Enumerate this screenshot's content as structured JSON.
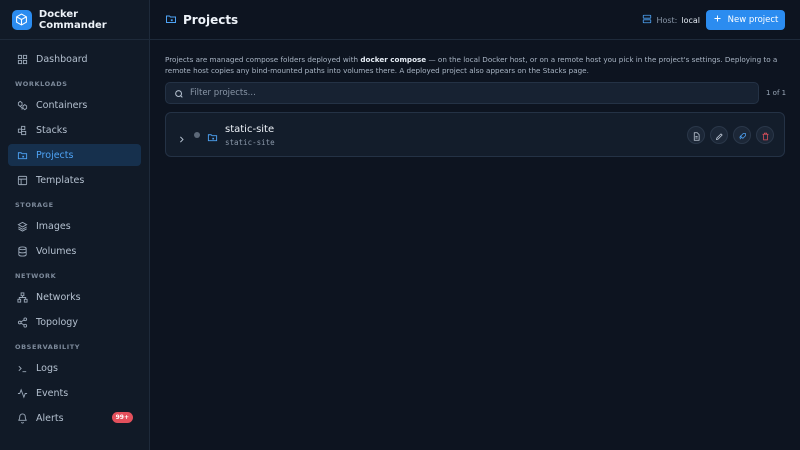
{
  "app": {
    "name": "Docker Commander"
  },
  "sidebar": {
    "dashboard": "Dashboard",
    "sections": {
      "workloads": "WORKLOADS",
      "storage": "STORAGE",
      "network": "NETWORK",
      "observability": "OBSERVABILITY"
    },
    "items": {
      "containers": "Containers",
      "stacks": "Stacks",
      "projects": "Projects",
      "templates": "Templates",
      "images": "Images",
      "volumes": "Volumes",
      "networks": "Networks",
      "topology": "Topology",
      "logs": "Logs",
      "events": "Events",
      "alerts": "Alerts"
    },
    "alerts_badge": "99+"
  },
  "header": {
    "title": "Projects",
    "host_label": "Host:",
    "host_value": "local",
    "new_button": "New project"
  },
  "main": {
    "description_pre": "Projects are managed compose folders deployed with ",
    "description_bold": "docker compose",
    "description_post": " — on the local Docker host, or on a remote host you pick in the project's settings. Deploying to a remote host copies any bind-mounted paths into volumes there. A deployed project also appears on the Stacks page.",
    "filter_placeholder": "Filter projects...",
    "pager": "1 of 1",
    "projects": [
      {
        "name": "static-site",
        "subtitle": "static-site"
      }
    ]
  },
  "colors": {
    "accent": "#2b8cf0",
    "active_bg": "#16304d",
    "danger": "#e3505c",
    "background": "#0d1420"
  }
}
